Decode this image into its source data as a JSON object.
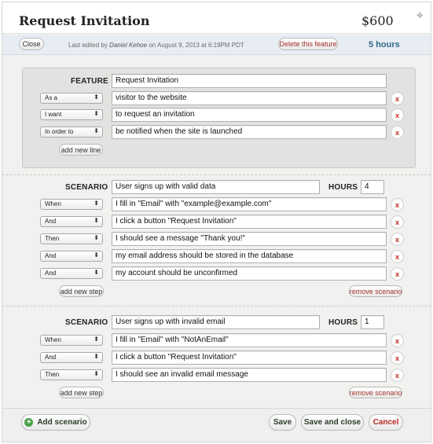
{
  "header": {
    "title": "Request Invitation",
    "price": "$600",
    "move_icon": "move-icon"
  },
  "metabar": {
    "close_label": "Close",
    "edited_prefix": "Last edited by",
    "edited_by": "Daniel Kehoe",
    "edited_suffix": "on August 9, 2013 at 6:19PM PDT",
    "delete_label": "Delete this feature",
    "hours_total": "5 hours"
  },
  "feature": {
    "label": "FEATURE",
    "name": "Request Invitation",
    "lines": [
      {
        "keyword": "As a",
        "text": "visitor to the website"
      },
      {
        "keyword": "I want",
        "text": "to request an invitation"
      },
      {
        "keyword": "In order to",
        "text": "be notified when the site is launched"
      }
    ],
    "add_line_label": "add new line"
  },
  "scenarios": [
    {
      "label": "SCENARIO",
      "name": "User signs up with valid data",
      "hours_label": "HOURS",
      "hours": "4",
      "steps": [
        {
          "keyword": "When",
          "text": "I fill in \"Email\" with \"example@example.com\""
        },
        {
          "keyword": "And",
          "text": "I click a button \"Request Invitation\""
        },
        {
          "keyword": "Then",
          "text": "I should see a message \"Thank you!\""
        },
        {
          "keyword": "And",
          "text": "my email address should be stored in the database"
        },
        {
          "keyword": "And",
          "text": "my account should be unconfirmed"
        }
      ],
      "add_step_label": "add new step",
      "remove_label": "remove scenario"
    },
    {
      "label": "SCENARIO",
      "name": "User signs up with invalid email",
      "hours_label": "HOURS",
      "hours": "1",
      "steps": [
        {
          "keyword": "When",
          "text": "I fill in \"Email\" with \"NotAnEmail\""
        },
        {
          "keyword": "And",
          "text": "I click a button \"Request Invitation\""
        },
        {
          "keyword": "Then",
          "text": "I should see an invalid email message"
        }
      ],
      "add_step_label": "add new step",
      "remove_label": "remove scenario"
    }
  ],
  "footer": {
    "add_scenario_label": "Add scenario",
    "save_label": "Save",
    "save_close_label": "Save and close",
    "cancel_label": "Cancel"
  },
  "icons": {
    "remove": "x-icon",
    "dropdown": "chevron-updown-icon",
    "add": "plus-circle-icon"
  },
  "colors": {
    "accent_blue": "#336a8a",
    "remove_red": "#c0271c",
    "add_green": "#4aa24a"
  }
}
